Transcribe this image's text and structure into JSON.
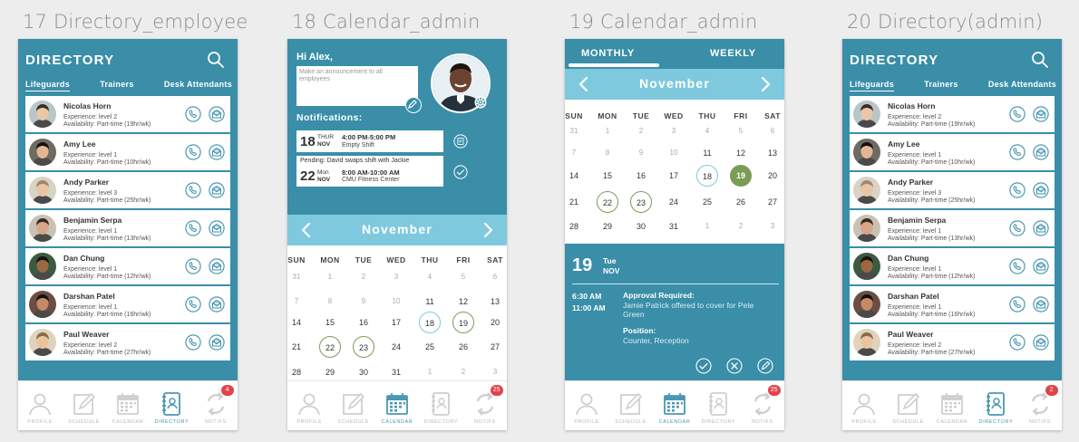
{
  "frames": {
    "f17": {
      "title": "17 Directory_employee"
    },
    "f18": {
      "title": "18 Calendar_admin"
    },
    "f19": {
      "title": "19 Calendar_admin"
    },
    "f20": {
      "title": "20 Directory(admin)"
    }
  },
  "directory": {
    "title": "DIRECTORY",
    "tabs": [
      "Lifeguards",
      "Trainers",
      "Desk Attendants"
    ],
    "employees": [
      {
        "name": "Nicolas Horn",
        "experience": "Experience: level 2",
        "availability": "Availability: Part-time (19hr/wk)"
      },
      {
        "name": "Amy Lee",
        "experience": "Experience: level 1",
        "availability": "Availability: Part-time (10hr/wk)"
      },
      {
        "name": "Andy Parker",
        "experience": "Experience: level 3",
        "availability": "Availability: Part-time (25hr/wk)"
      },
      {
        "name": "Benjamin Serpa",
        "experience": "Experience: level 1",
        "availability": "Availability: Part-time (13hr/wk)"
      },
      {
        "name": "Dan Chung",
        "experience": "Experience: level 1",
        "availability": "Availability: Part-time (12hr/wk)"
      },
      {
        "name": "Darshan Patel",
        "experience": "Experience: level 1",
        "availability": "Availability: Part-time (16hr/wk)"
      },
      {
        "name": "Paul Weaver",
        "experience": "Experience: level 2",
        "availability": "Availability: Part-time (27hr/wk)"
      }
    ]
  },
  "nav": {
    "items": [
      "PROFILE",
      "SCHEDULE",
      "CALENDAR",
      "DIRECTORY",
      "NOTIFS"
    ],
    "badge_f17": "4",
    "badge_f18": "25",
    "badge_f19": "25",
    "badge_f20": "2"
  },
  "calendar": {
    "month": "November",
    "weekdays": [
      "SUN",
      "MON",
      "TUE",
      "WED",
      "THU",
      "FRI",
      "SAT"
    ],
    "rows": [
      [
        "31",
        "1",
        "2",
        "3",
        "4",
        "5",
        "6"
      ],
      [
        "7",
        "8",
        "9",
        "10",
        "11",
        "12",
        "13"
      ],
      [
        "14",
        "15",
        "16",
        "17",
        "18",
        "19",
        "20"
      ],
      [
        "21",
        "22",
        "23",
        "24",
        "25",
        "26",
        "27"
      ],
      [
        "28",
        "29",
        "30",
        "31",
        "1",
        "2",
        "3"
      ]
    ]
  },
  "admin_home": {
    "greeting": "Hi Alex,",
    "announcement_placeholder": "Make an announcement to all employees",
    "notifications_title": "Notifications:",
    "notifications": [
      {
        "date": "18",
        "weekday": "THUR",
        "month": "NOV",
        "pending": "",
        "time": "4:00 PM-5:00 PM",
        "desc": "Empty Shift"
      },
      {
        "date": "22",
        "weekday": "Mon",
        "month": "NOV",
        "pending": "Pending: David swaps shift with Jackie",
        "time": "8:00 AM-10:00 AM",
        "desc": "CMU Fitness Center"
      }
    ]
  },
  "calendar_admin": {
    "tabs": [
      "MONTHLY",
      "WEEKLY"
    ],
    "selected_day": "19",
    "selected_weekday": "Tue",
    "selected_month": "NOV",
    "time_start": "6:30 AM",
    "time_end": "11:00 AM",
    "approval_head": "Approval Required:",
    "approval_text": "Jamie Patrick offered to cover for Pete Green",
    "position_head": "Position:",
    "position_text": "Counter, Reception"
  },
  "colors": {
    "teal": "#3a8ea8",
    "light_teal": "#7ec9dd",
    "green": "#7b9c55",
    "badge": "#e2434b"
  }
}
